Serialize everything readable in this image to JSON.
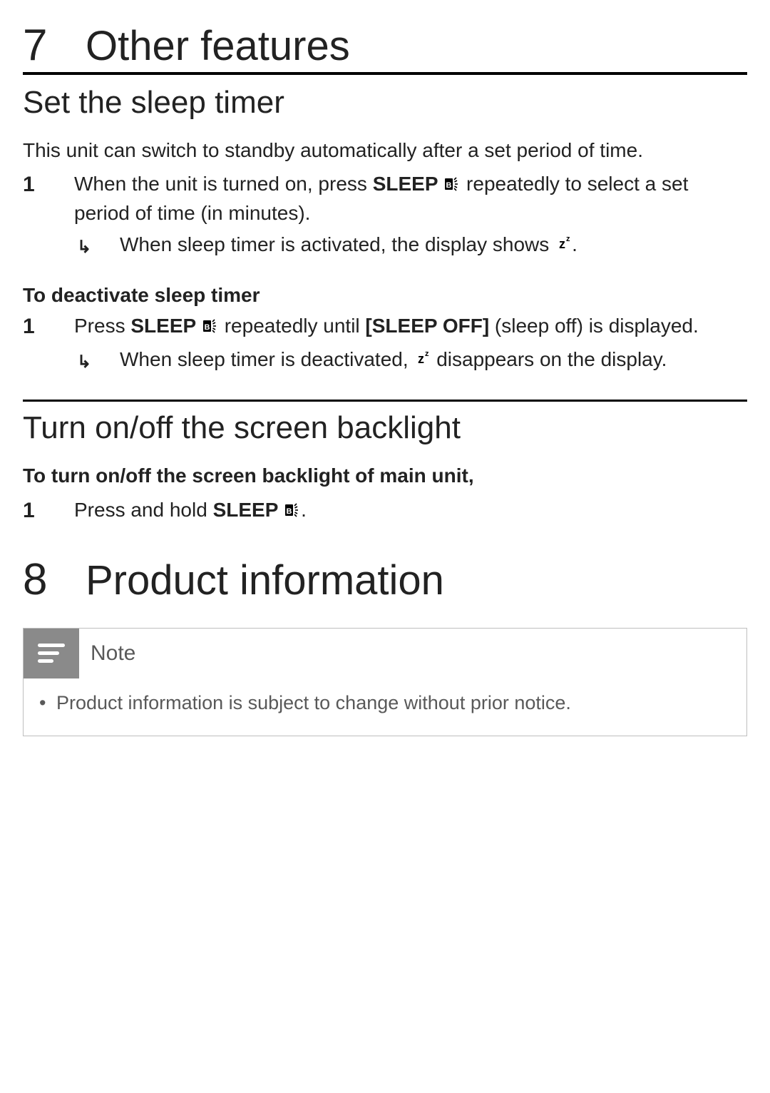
{
  "chapter7": {
    "num": "7",
    "title": "Other features"
  },
  "s1": {
    "heading": "Set the sleep timer",
    "intro": "This unit can switch to standby automatically after a set period of time.",
    "step1_num": "1",
    "step1_a": "When the unit is turned on, press ",
    "step1_sleep": "SLEEP",
    "step1_b": " repeatedly to select a set period of time (in minutes).",
    "result1_a": "When sleep timer is activated, the display shows ",
    "result1_zz": "z",
    "result1_b": "."
  },
  "s2": {
    "heading": "To deactivate sleep timer",
    "step1_num": "1",
    "step1_a": "Press ",
    "step1_sleep": "SLEEP",
    "step1_b": " repeatedly until ",
    "step1_sleepoff": "[SLEEP OFF]",
    "step1_c": " (sleep off) is displayed.",
    "result1_a": "When sleep timer is deactivated, ",
    "result1_zz": "z",
    "result1_b": " disappears on the display."
  },
  "s3": {
    "heading": "Turn on/off the screen backlight",
    "intro": "To turn on/off the screen backlight of main unit,",
    "step1_num": "1",
    "step1_a": "Press and hold ",
    "step1_sleep": "SLEEP",
    "step1_b": "."
  },
  "chapter8": {
    "num": "8",
    "title": "Product information"
  },
  "note": {
    "title": "Note",
    "bullet1": "Product information is subject to change without prior notice."
  }
}
